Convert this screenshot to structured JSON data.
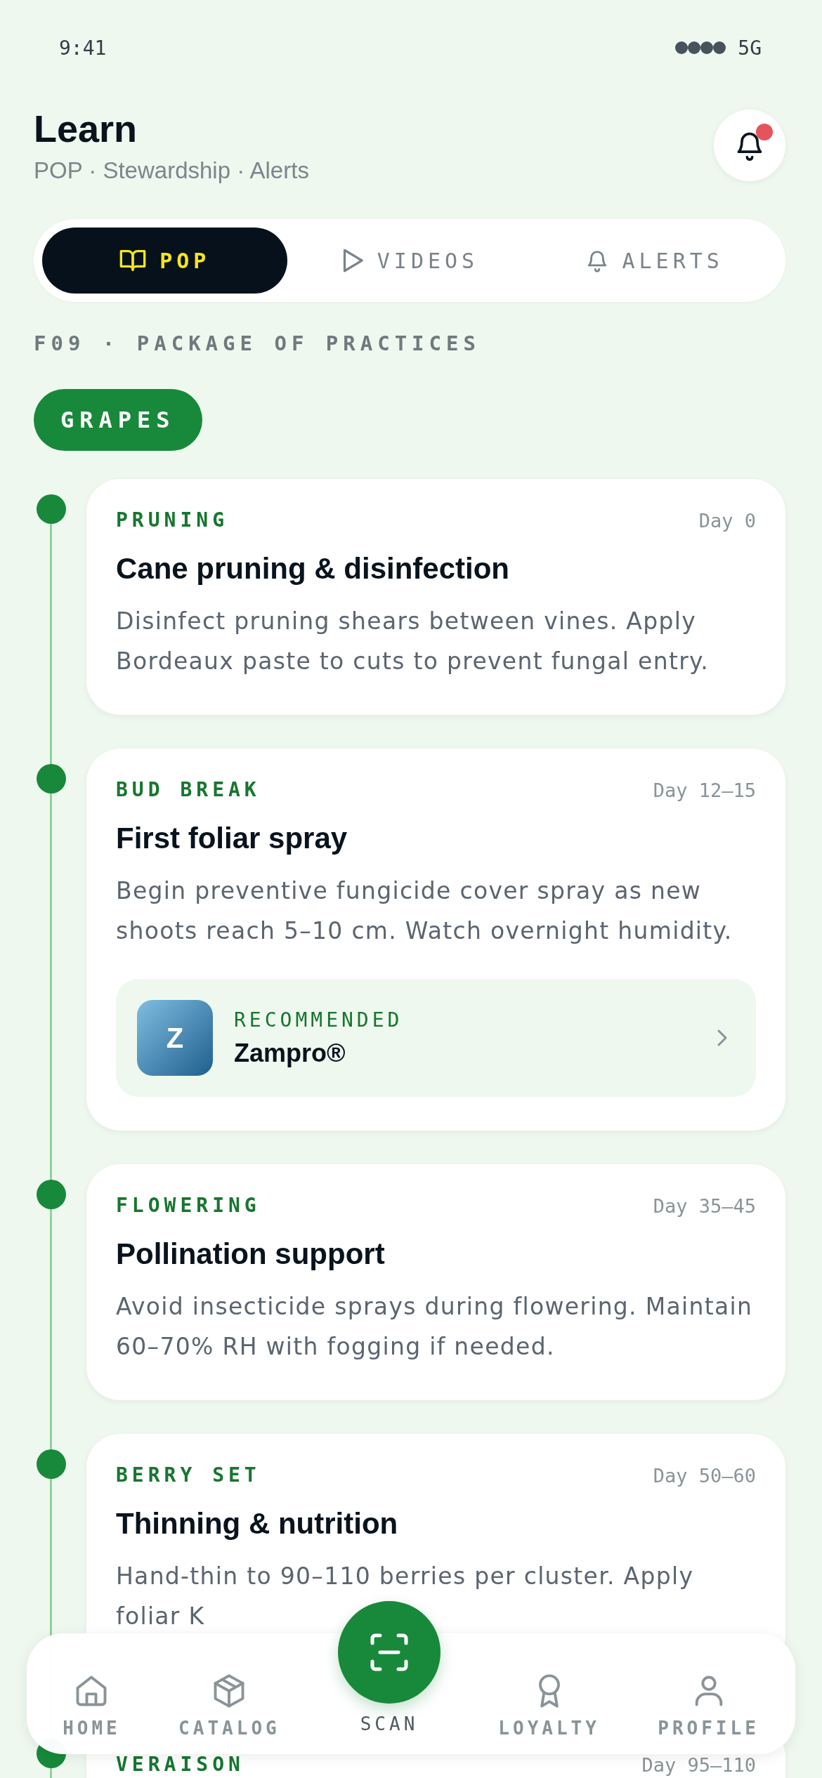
{
  "status_bar": {
    "time": "9:41",
    "network": "5G"
  },
  "header": {
    "title": "Learn",
    "subtitle": "POP · Stewardship · Alerts",
    "notifications_unread": true
  },
  "tabs": [
    {
      "label": "POP",
      "selected": true
    },
    {
      "label": "VIDEOS",
      "selected": false
    },
    {
      "label": "ALERTS",
      "selected": false
    }
  ],
  "section_label": "F09 · PACKAGE OF PRACTICES",
  "crop_chip": {
    "label": "GRAPES",
    "selected": true
  },
  "stages": [
    {
      "stage": "PRUNING",
      "day": "Day 0",
      "title": "Cane pruning & disinfection",
      "description": "Disinfect pruning shears between vines. Apply Bordeaux paste to cuts to prevent fungal entry."
    },
    {
      "stage": "BUD BREAK",
      "day": "Day 12–15",
      "title": "First foliar spray",
      "description": "Begin preventive fungicide cover spray as new shoots reach 5–10 cm. Watch overnight humidity.",
      "recommendation": {
        "label": "RECOMMENDED",
        "logo": "Z",
        "name": "Zampro®"
      }
    },
    {
      "stage": "FLOWERING",
      "day": "Day 35–45",
      "title": "Pollination support",
      "description": "Avoid insecticide sprays during flowering. Maintain 60–70% RH with fogging if needed."
    },
    {
      "stage": "BERRY SET",
      "day": "Day 50–60",
      "title": "Thinning & nutrition",
      "description": "Hand-thin to 90–110 berries per cluster. Apply foliar K"
    },
    {
      "stage": "VERAISON",
      "day": "Day 95–110"
    }
  ],
  "nav": [
    {
      "kind": "tab",
      "label": "HOME"
    },
    {
      "kind": "tab",
      "label": "CATALOG"
    },
    {
      "kind": "scan",
      "label": "SCAN"
    },
    {
      "kind": "tab",
      "label": "LOYALTY"
    },
    {
      "kind": "tab",
      "label": "PROFILE"
    }
  ]
}
